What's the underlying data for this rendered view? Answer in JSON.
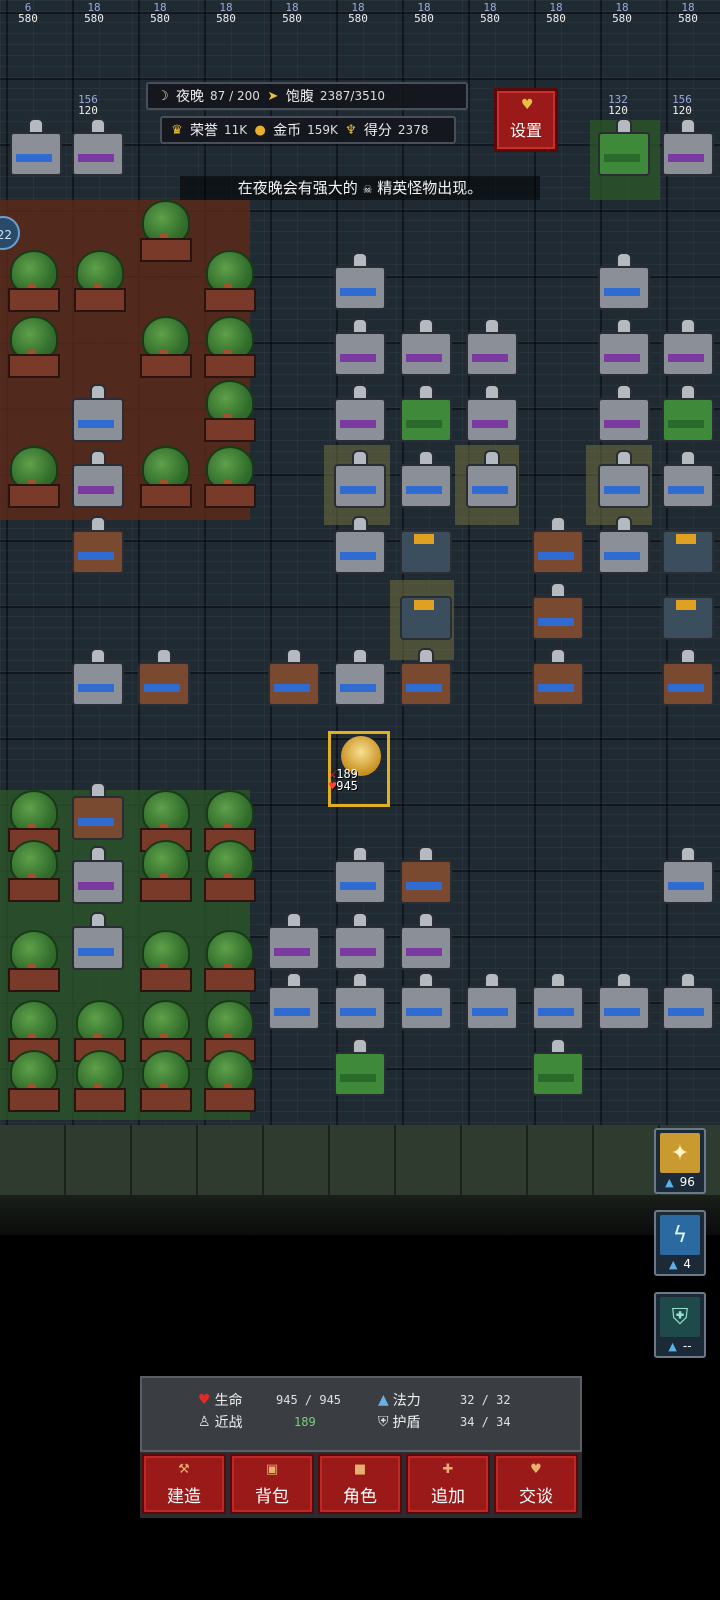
{
  "top_stats": {
    "cells": [
      {
        "a": "6",
        "b": "580"
      },
      {
        "a": "18",
        "b": "580"
      },
      {
        "a": "18",
        "b": "580"
      },
      {
        "a": "18",
        "b": "580"
      },
      {
        "a": "18",
        "b": "580"
      },
      {
        "a": "18",
        "b": "580"
      },
      {
        "a": "18",
        "b": "580"
      },
      {
        "a": "18",
        "b": "580"
      },
      {
        "a": "18",
        "b": "580"
      },
      {
        "a": "18",
        "b": "580"
      },
      {
        "a": "18",
        "b": "580"
      }
    ],
    "left_pair": {
      "a": "156",
      "b": "120"
    },
    "right_pair": {
      "a": "132",
      "b": "120"
    },
    "right_pair2": {
      "a": "156",
      "b": "120"
    },
    "side_badge": "22"
  },
  "hud": {
    "time_label": "夜晚",
    "time_value": "87 / 200",
    "hunger_label": "饱腹",
    "hunger_value": "2387/3510",
    "honor_label": "荣誉",
    "honor_value": "11K",
    "gold_label": "金币",
    "gold_value": "159K",
    "score_label": "得分",
    "score_value": "2378"
  },
  "settings": {
    "label": "设置"
  },
  "notice": {
    "prefix": "在夜晚会有强大的",
    "suffix": "精英怪物出现。"
  },
  "player": {
    "hp_a": "189",
    "hp_b": "945"
  },
  "skills": [
    {
      "icon": "sparkle-icon",
      "count": "96"
    },
    {
      "icon": "lightning-icon",
      "count": "4"
    },
    {
      "icon": "shield-icon",
      "count": "--"
    }
  ],
  "status": {
    "life_label": "生命",
    "life_value": "945 / 945",
    "melee_label": "近战",
    "melee_value": "189",
    "mana_label": "法力",
    "mana_value": "32 / 32",
    "shield_label": "护盾",
    "shield_value": "34 / 34"
  },
  "actions": [
    {
      "label": "建造",
      "icon": "hammer-icon"
    },
    {
      "label": "背包",
      "icon": "bag-icon"
    },
    {
      "label": "角色",
      "icon": "character-icon"
    },
    {
      "label": "追加",
      "icon": "plus-icon"
    },
    {
      "label": "交谈",
      "icon": "chat-icon"
    }
  ],
  "colors": {
    "accent_red": "#9a1a1a",
    "gold": "#e0b020",
    "mana_blue": "#5ab0e8"
  }
}
